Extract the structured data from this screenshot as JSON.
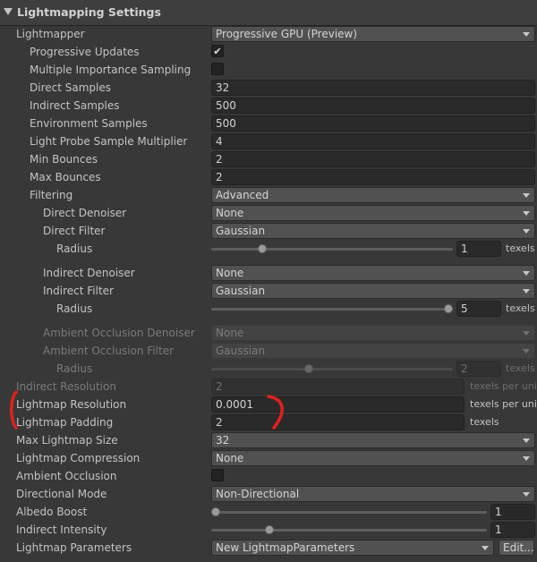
{
  "header": {
    "title": "Lightmapping Settings"
  },
  "units": {
    "texels": "texels",
    "texels_per_unit": "texels per unit"
  },
  "lightmapper": {
    "label": "Lightmapper",
    "value": "Progressive GPU (Preview)"
  },
  "progressive_updates": {
    "label": "Progressive Updates",
    "checked": true,
    "check_glyph": "✔"
  },
  "mis": {
    "label": "Multiple Importance Sampling",
    "checked": false
  },
  "direct_samples": {
    "label": "Direct Samples",
    "value": "32"
  },
  "indirect_samples": {
    "label": "Indirect Samples",
    "value": "500"
  },
  "environment_samples": {
    "label": "Environment Samples",
    "value": "500"
  },
  "probe_multiplier": {
    "label": "Light Probe Sample Multiplier",
    "value": "4"
  },
  "min_bounces": {
    "label": "Min Bounces",
    "value": "2"
  },
  "max_bounces": {
    "label": "Max Bounces",
    "value": "2"
  },
  "filtering": {
    "label": "Filtering",
    "value": "Advanced"
  },
  "direct_denoiser": {
    "label": "Direct Denoiser",
    "value": "None"
  },
  "direct_filter": {
    "label": "Direct Filter",
    "value": "Gaussian"
  },
  "direct_radius": {
    "label": "Radius",
    "value": "1",
    "slider_fraction": 0.2
  },
  "indirect_denoiser": {
    "label": "Indirect Denoiser",
    "value": "None"
  },
  "indirect_filter": {
    "label": "Indirect Filter",
    "value": "Gaussian"
  },
  "indirect_radius": {
    "label": "Radius",
    "value": "5",
    "slider_fraction": 1.0
  },
  "ao_denoiser": {
    "label": "Ambient Occlusion Denoiser",
    "value": "None"
  },
  "ao_filter": {
    "label": "Ambient Occlusion Filter",
    "value": "Gaussian"
  },
  "ao_radius": {
    "label": "Radius",
    "value": "2",
    "slider_fraction": 0.4
  },
  "indirect_resolution": {
    "label": "Indirect Resolution",
    "value": "2"
  },
  "lightmap_resolution": {
    "label": "Lightmap Resolution",
    "value": "0.0001"
  },
  "lightmap_padding": {
    "label": "Lightmap Padding",
    "value": "2"
  },
  "max_lightmap_size": {
    "label": "Max Lightmap Size",
    "value": "32"
  },
  "lightmap_compression": {
    "label": "Lightmap Compression",
    "value": "None"
  },
  "ambient_occlusion": {
    "label": "Ambient Occlusion",
    "checked": false
  },
  "directional_mode": {
    "label": "Directional Mode",
    "value": "Non-Directional"
  },
  "albedo_boost": {
    "label": "Albedo Boost",
    "value": "1",
    "slider_fraction": 0.0
  },
  "indirect_intensity": {
    "label": "Indirect Intensity",
    "value": "1",
    "slider_fraction": 0.2
  },
  "lightmap_parameters": {
    "label": "Lightmap Parameters",
    "value": "New LightmapParameters",
    "edit_label": "Edit..."
  },
  "colors": {
    "annotation": "#e0201e",
    "background": "#383838"
  }
}
